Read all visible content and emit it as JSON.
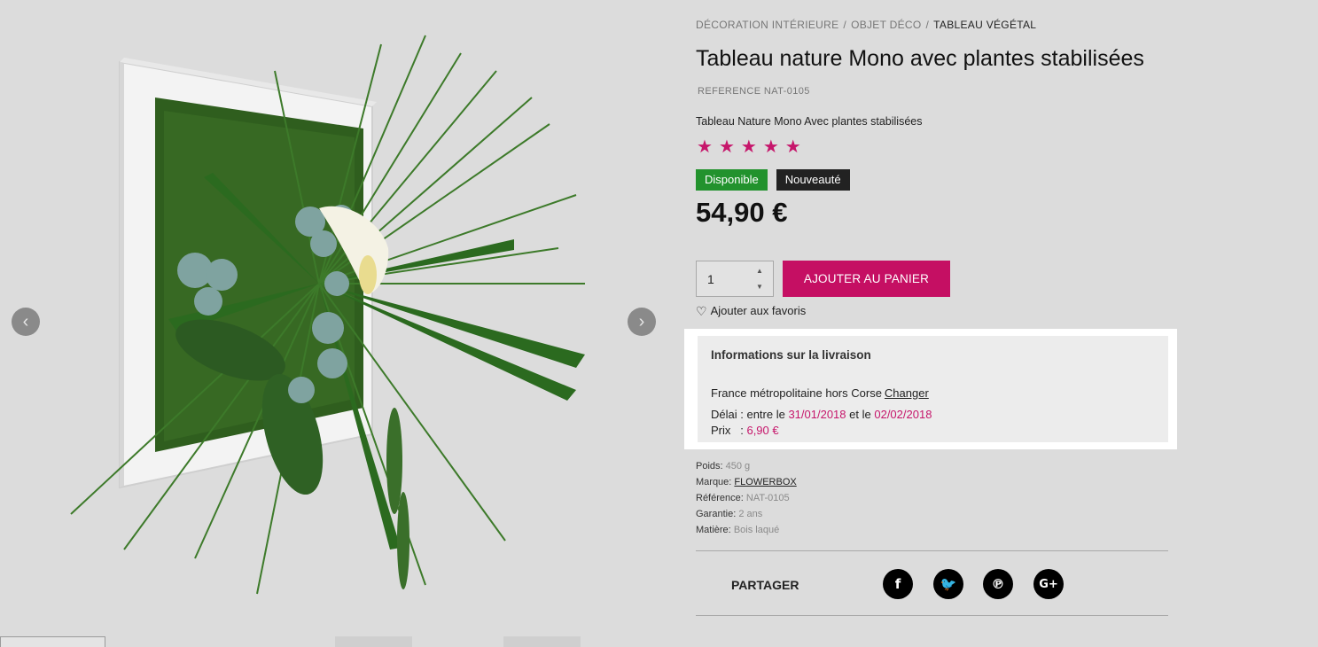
{
  "breadcrumb": {
    "items": [
      "DÉCORATION INTÉRIEURE",
      "OBJET DÉCO"
    ],
    "current": "TABLEAU VÉGÉTAL",
    "separator": "/"
  },
  "product": {
    "title": "Tableau nature Mono avec plantes stabilisées",
    "reference": "REFERENCE NAT-0105",
    "short_description": "Tableau Nature Mono Avec plantes stabilisées",
    "rating": {
      "stars": 5,
      "max": 5,
      "glyph": "★"
    },
    "badges": {
      "available": "Disponible",
      "new": "Nouveauté"
    },
    "price": "54,90 €"
  },
  "cart": {
    "quantity": "1",
    "up_glyph": "▲",
    "down_glyph": "▼",
    "add_label": "AJOUTER AU PANIER",
    "favorite_label": "Ajouter aux favoris",
    "heart_glyph": "♡"
  },
  "delivery": {
    "title": "Informations sur la livraison",
    "region": "France métropolitaine hors Corse",
    "change_label": "Changer",
    "delay_prefix": "Délai : entre le",
    "date_from": "31/01/2018",
    "delay_mid": "et le",
    "date_to": "02/02/2018",
    "price_label": "Prix   :",
    "price_value": "6,90 €"
  },
  "specs": {
    "weight_label": "Poids:",
    "weight": "450 g",
    "brand_label": "Marque:",
    "brand": "FLOWERBOX",
    "reference_label": "Référence:",
    "reference": "NAT-0105",
    "warranty_label": "Garantie:",
    "warranty": "2 ans",
    "material_label": "Matière:",
    "material": "Bois laqué"
  },
  "share": {
    "label": "PARTAGER",
    "facebook": "f",
    "twitter": "🐦",
    "pinterest": "℗",
    "googleplus": "G+"
  },
  "gallery": {
    "prev": "‹",
    "next": "›"
  },
  "colors": {
    "accent": "#c50f63",
    "available": "#22922d",
    "background": "#dcdcdc"
  }
}
